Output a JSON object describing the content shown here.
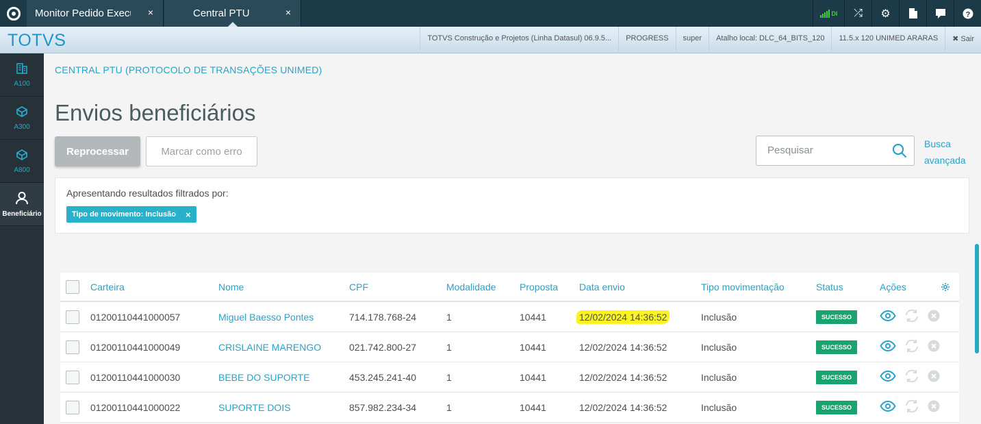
{
  "tabs": [
    {
      "label": "Monitor Pedido Execução",
      "close": "×"
    },
    {
      "label": "Central PTU",
      "close": "×"
    }
  ],
  "top_icons": {
    "signal_text": "DI",
    "shuffle": "⤮",
    "gear": "⚙",
    "file": "🗎",
    "chat": "▬",
    "help": "?"
  },
  "header": {
    "brand": "TOTVS",
    "info": [
      "TOTVS Construção e Projetos (Linha Datasul) 06.9.5...",
      "PROGRESS",
      "super",
      "Atalho local: DLC_64_BITS_120",
      "11.5.x 120 UNIMED ARARAS"
    ],
    "exit": "✖ Sair"
  },
  "sidebar": {
    "items": [
      {
        "label": "A100",
        "icon": "building-icon"
      },
      {
        "label": "A300",
        "icon": "cube-icon"
      },
      {
        "label": "A800",
        "icon": "cube-icon"
      },
      {
        "label": "Beneficiário",
        "icon": "user-icon"
      }
    ]
  },
  "main": {
    "breadcrumb": "CENTRAL PTU (PROTOCOLO DE TRANSAÇÕES UNIMED)",
    "title": "Envios beneficiários",
    "btn_reprocess": "Reprocessar",
    "btn_mark_error": "Marcar como erro",
    "search_placeholder": "Pesquisar",
    "busca_line1": "Busca",
    "busca_line2": "avançada",
    "filter_title": "Apresentando resultados filtrados por:",
    "filter_chip": "Tipo de movimento: Inclusão",
    "chip_close": "×"
  },
  "table": {
    "headers": [
      "Carteira",
      "Nome",
      "CPF",
      "Modalidade",
      "Proposta",
      "Data envio",
      "Tipo movimentação",
      "Status",
      "Ações"
    ],
    "rows": [
      {
        "carteira": "01200110441000057",
        "nome": "Miguel Baesso Pontes",
        "cpf": "714.178.768-24",
        "modalidade": "1",
        "proposta": "10441",
        "data": "12/02/2024 14:36:52",
        "tipo": "Inclusão",
        "status": "SUCESSO"
      },
      {
        "carteira": "01200110441000049",
        "nome": "CRISLAINE MARENGO",
        "cpf": "021.742.800-27",
        "modalidade": "1",
        "proposta": "10441",
        "data": "12/02/2024 14:36:52",
        "tipo": "Inclusão",
        "status": "SUCESSO"
      },
      {
        "carteira": "01200110441000030",
        "nome": "BEBE DO SUPORTE",
        "cpf": "453.245.241-40",
        "modalidade": "1",
        "proposta": "10441",
        "data": "12/02/2024 14:36:52",
        "tipo": "Inclusão",
        "status": "SUCESSO"
      },
      {
        "carteira": "01200110441000022",
        "nome": "SUPORTE DOIS",
        "cpf": "857.982.234-34",
        "modalidade": "1",
        "proposta": "10441",
        "data": "12/02/2024 14:36:52",
        "tipo": "Inclusão",
        "status": "SUCESSO"
      }
    ]
  },
  "colors": {
    "accent": "#29a2c9",
    "success": "#1aa36e",
    "topbar": "#1d3a48",
    "highlight": "#fdf324"
  }
}
